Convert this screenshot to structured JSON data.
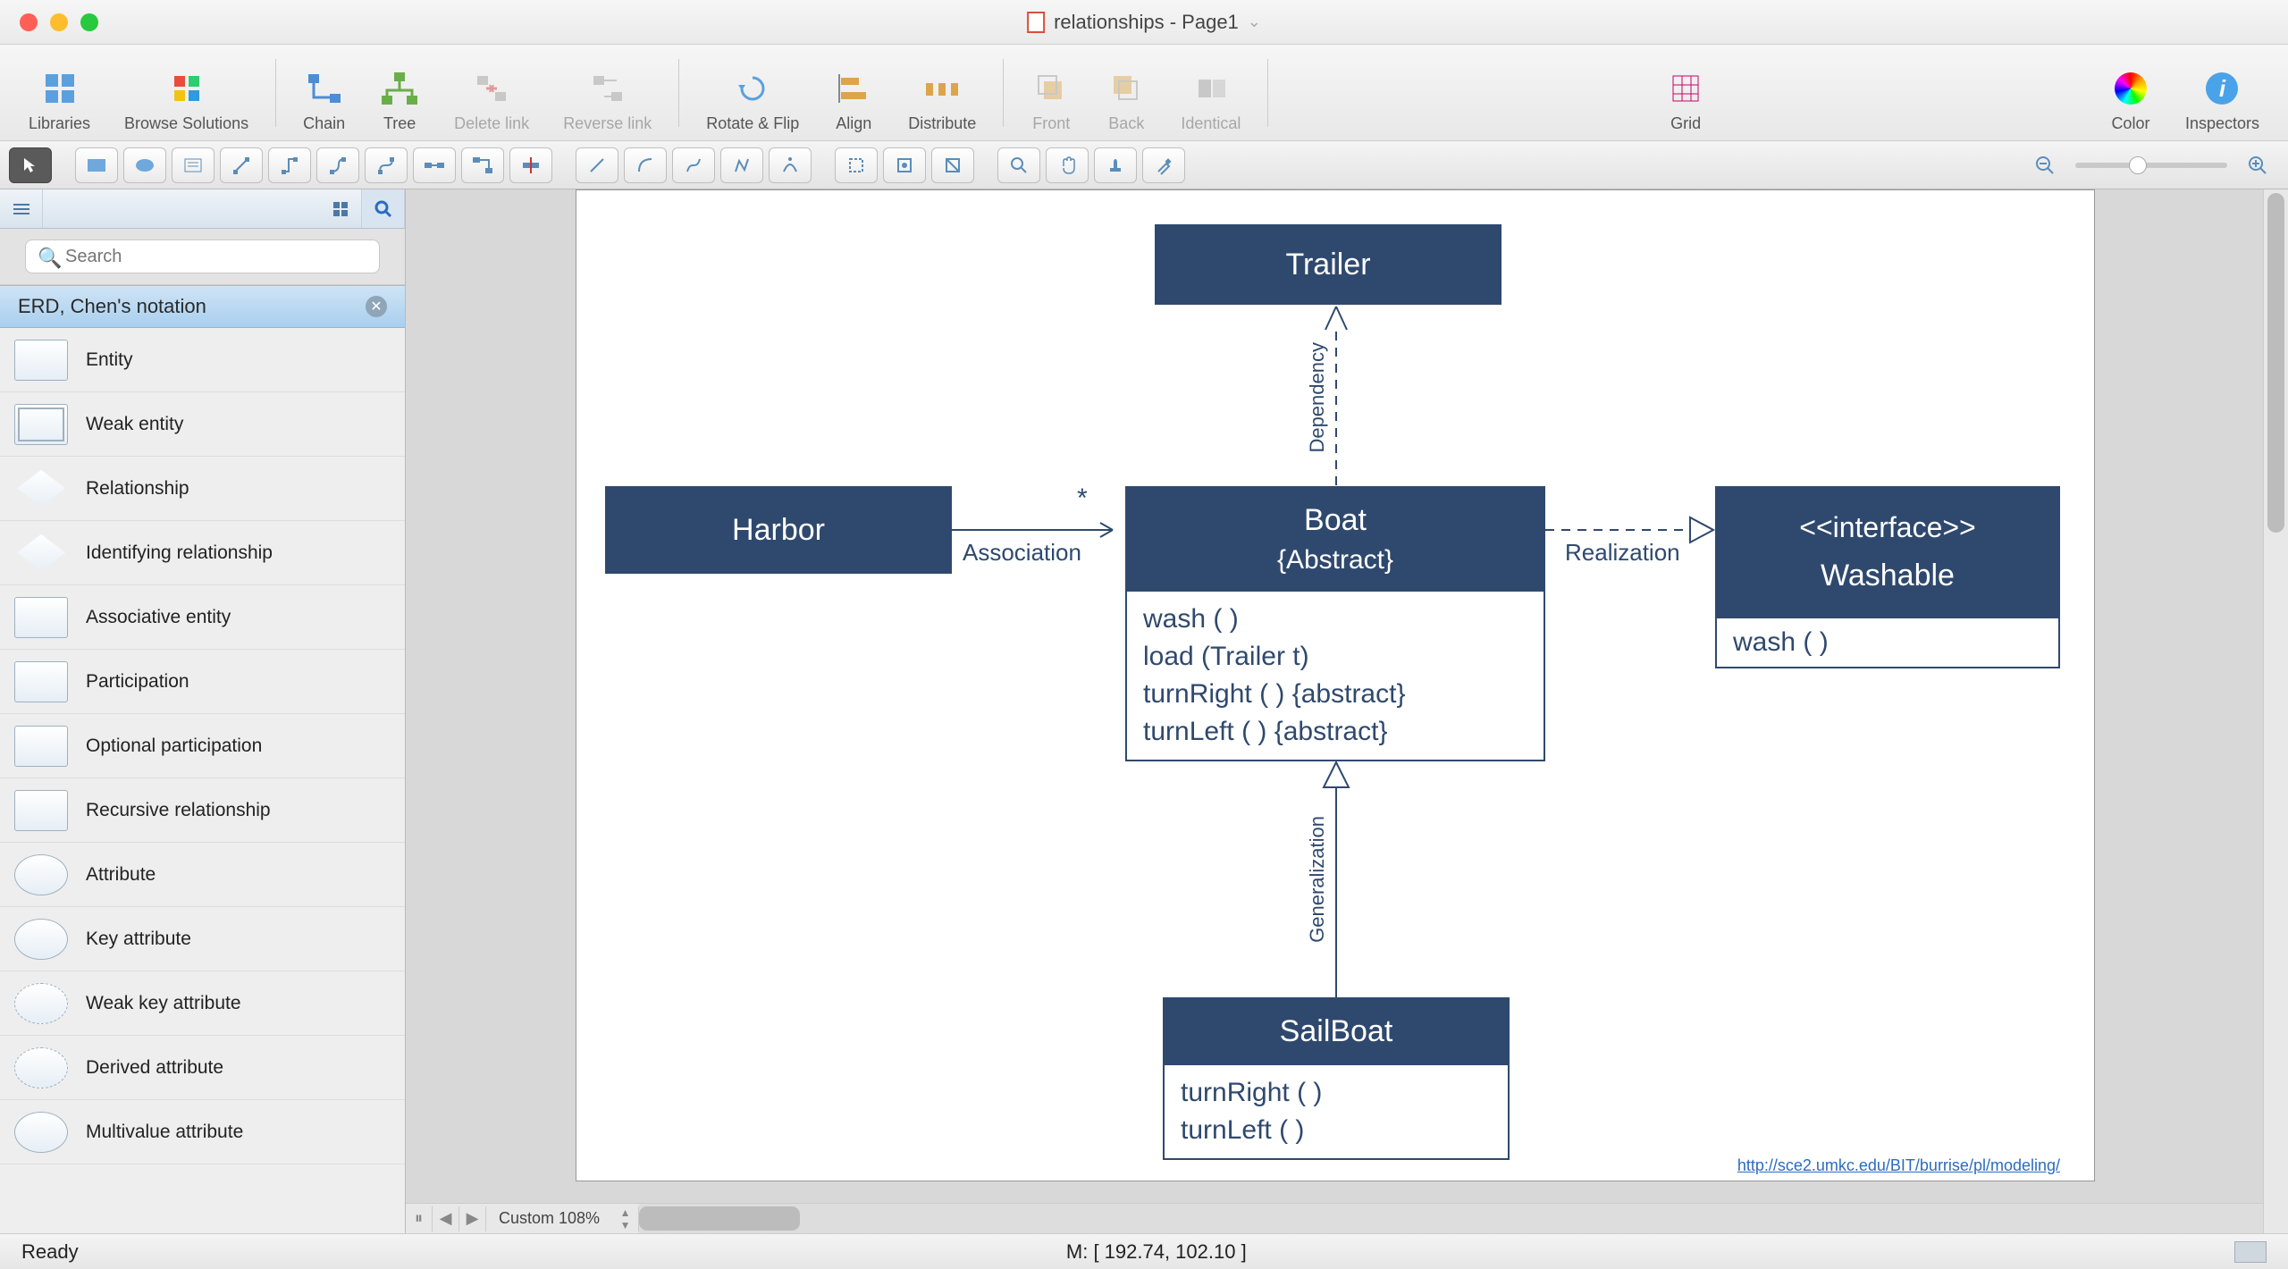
{
  "title": "relationships - Page1",
  "toolbar": [
    {
      "label": "Libraries",
      "disabled": false
    },
    {
      "label": "Browse Solutions",
      "disabled": false
    },
    {
      "label": "Chain",
      "disabled": false
    },
    {
      "label": "Tree",
      "disabled": false
    },
    {
      "label": "Delete link",
      "disabled": true
    },
    {
      "label": "Reverse link",
      "disabled": true
    },
    {
      "label": "Rotate & Flip",
      "disabled": false
    },
    {
      "label": "Align",
      "disabled": false
    },
    {
      "label": "Distribute",
      "disabled": false
    },
    {
      "label": "Front",
      "disabled": true
    },
    {
      "label": "Back",
      "disabled": true
    },
    {
      "label": "Identical",
      "disabled": true
    },
    {
      "label": "Grid",
      "disabled": false
    },
    {
      "label": "Color",
      "disabled": false
    },
    {
      "label": "Inspectors",
      "disabled": false
    }
  ],
  "search_placeholder": "Search",
  "library_header": "ERD, Chen's notation",
  "library_items": [
    "Entity",
    "Weak entity",
    "Relationship",
    "Identifying relationship",
    "Associative entity",
    "Participation",
    "Optional participation",
    "Recursive relationship",
    "Attribute",
    "Key attribute",
    "Weak key attribute",
    "Derived attribute",
    "Multivalue attribute"
  ],
  "diagram": {
    "trailer": "Trailer",
    "harbor": "Harbor",
    "boat_title": "Boat",
    "boat_sub": "{Abstract}",
    "boat_methods": [
      "wash ( )",
      "load (Trailer t)",
      "turnRight ( ) {abstract}",
      "turnLeft ( ) {abstract}"
    ],
    "washable_top": "<<interface>>",
    "washable_name": "Washable",
    "washable_methods": [
      "wash ( )"
    ],
    "sailboat": "SailBoat",
    "sailboat_methods": [
      "turnRight ( )",
      "turnLeft ( )"
    ],
    "association": "Association",
    "realization": "Realization",
    "generalization": "Generalization",
    "dependency": "Dependency",
    "mult": "*",
    "srclink": "http://sce2.umkc.edu/BIT/burrise/pl/modeling/"
  },
  "bottom": {
    "zoom": "Custom 108%"
  },
  "status": {
    "left": "Ready",
    "mid": "M: [ 192.74, 102.10 ]"
  }
}
